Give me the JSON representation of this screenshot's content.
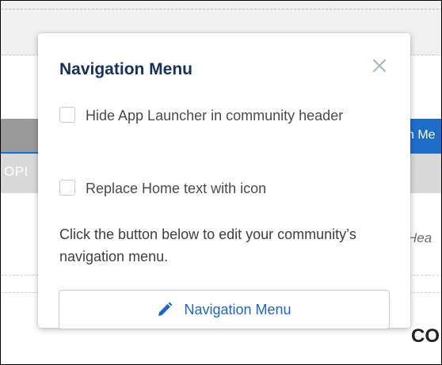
{
  "background": {
    "nav_highlight_text": "n Me",
    "subnav_text": "OPI",
    "italic_text": "Hea",
    "big_text": "CO"
  },
  "popover": {
    "title": "Navigation Menu",
    "close_icon": "close-icon",
    "options": [
      {
        "label": "Hide App Launcher in community header",
        "checked": false
      },
      {
        "label": "Replace Home text with icon",
        "checked": false
      }
    ],
    "description": "Click the button below to edit your community’s navigation menu.",
    "button_label": "Navigation Menu",
    "button_icon": "pencil-icon"
  },
  "colors": {
    "title": "#16325c",
    "accent": "#1b66c9",
    "nav_highlight": "#1e6ec9"
  }
}
